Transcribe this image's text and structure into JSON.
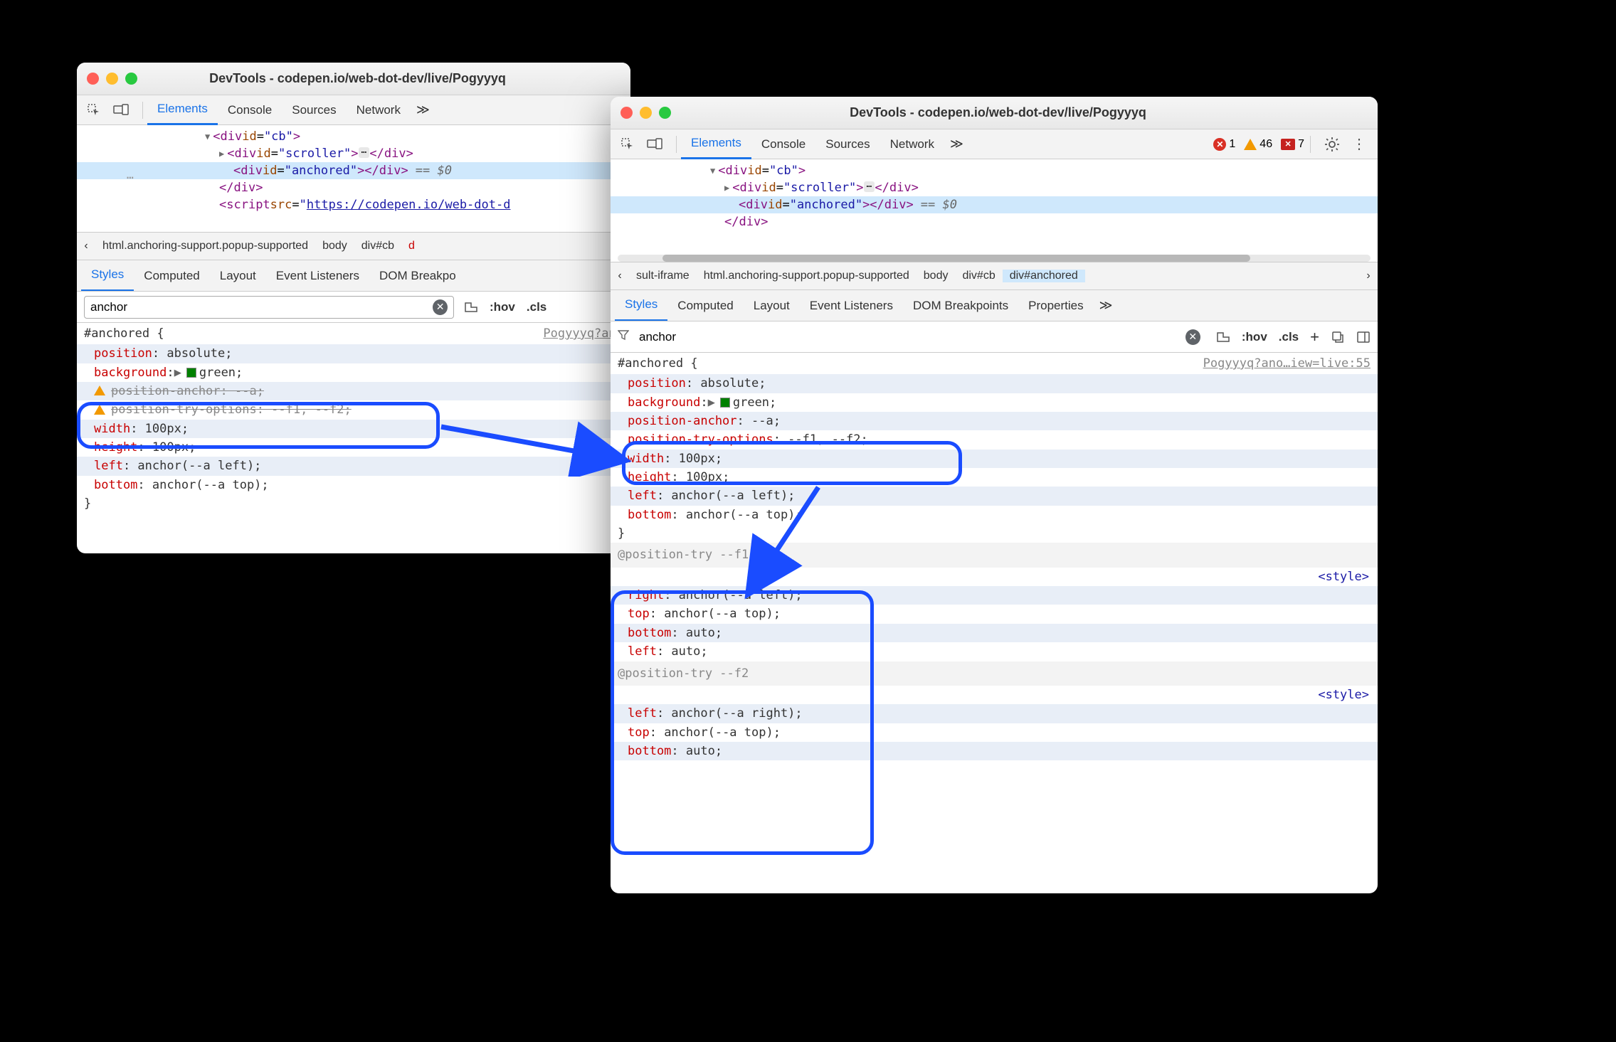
{
  "window_title": "DevTools - codepen.io/web-dot-dev/live/Pogyyyq",
  "toolbar_tabs": {
    "elements": "Elements",
    "console": "Console",
    "sources": "Sources",
    "network": "Network"
  },
  "counters": {
    "errors": "1",
    "warnings": "46",
    "violations": "7"
  },
  "dom": {
    "cb_open": "<div id=\"cb\">",
    "scroller": "<div id=\"scroller\">…</div>",
    "anchored": "<div id=\"anchored\"></div>",
    "eq": "== $0",
    "close": "</div>",
    "script": "<script src=\"https://codepen.io/web-dot-d…"
  },
  "crumbs1": {
    "a": "html.anchoring-support.popup-supported",
    "b": "body",
    "c": "div#cb"
  },
  "crumbs2": {
    "pre": "sult-iframe",
    "a": "html.anchoring-support.popup-supported",
    "b": "body",
    "c": "div#cb",
    "d": "div#anchored"
  },
  "styles_tabs": {
    "styles": "Styles",
    "computed": "Computed",
    "layout": "Layout",
    "listeners": "Event Listeners",
    "dom_bp": "DOM Breakpoints",
    "dom_bp_short": "DOM Breakpo",
    "properties": "Properties"
  },
  "filter": {
    "value": "anchor",
    "hov": ":hov",
    "cls": ".cls"
  },
  "stylesrc1": "Pogyyyq?an…",
  "stylesrc2": "Pogyyyq?ano…iew=live:55",
  "rule": {
    "selector": "#anchored {",
    "position": "position",
    "position_v": ": absolute;",
    "background": "background",
    "background_v": ": ",
    "background_v2": "green;",
    "pos_anchor": "position-anchor",
    "pos_anchor_v": ": --a;",
    "pos_try": "position-try-options",
    "pos_try_v": ": --f1, --f2;",
    "width": "width",
    "width_v": ": 100px;",
    "height": "height",
    "height_v": ": 100px;",
    "left": "left",
    "left_v": ": anchor(--a left);",
    "bottom": "bottom",
    "bottom_v": ": anchor(--a top);",
    "close": "}"
  },
  "ptry": {
    "f1_hdr": "@position-try --f1",
    "f2_hdr": "@position-try --f2",
    "style_link": "<style>",
    "right": "right",
    "right_v": ": anchor(--a left);",
    "top": "top",
    "top_v": ": anchor(--a top);",
    "bottom": "bottom",
    "bottom_v": ": auto;",
    "left": "left",
    "left_v": ": auto;",
    "left2_v": ": anchor(--a right);"
  }
}
